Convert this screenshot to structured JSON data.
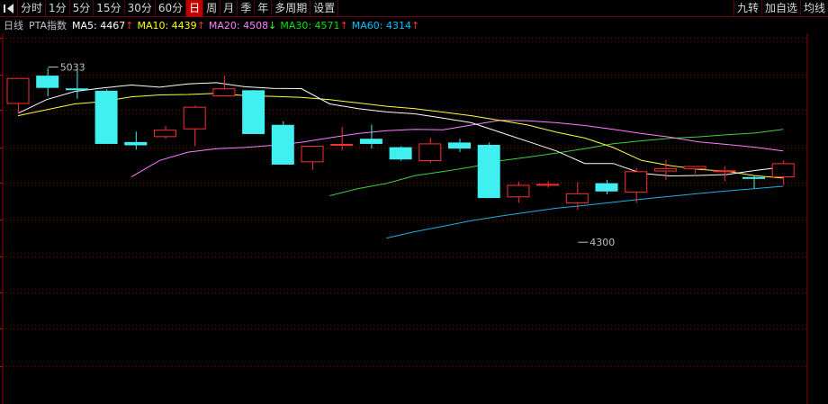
{
  "toolbar": {
    "tabs": [
      "分时",
      "1分",
      "5分",
      "15分",
      "30分",
      "60分",
      "日",
      "周",
      "月",
      "季",
      "年",
      "多周期",
      "设置"
    ],
    "active": "日",
    "right": [
      "九转",
      "加自选",
      "均线"
    ]
  },
  "legend": {
    "period": "日线",
    "name": "PTA指数",
    "items": [
      {
        "label": "MA5: 4467",
        "arrow": "↑",
        "color": "#ffffff",
        "arrow_color": "#ff3030"
      },
      {
        "label": "MA10: 4439",
        "arrow": "↑",
        "color": "#ffff00",
        "arrow_color": "#ff3030"
      },
      {
        "label": "MA20: 4508",
        "arrow": "↓",
        "color": "#ff80ff",
        "arrow_color": "#40ff40"
      },
      {
        "label": "MA30: 4571",
        "arrow": "↑",
        "color": "#00e000",
        "arrow_color": "#ff3030"
      },
      {
        "label": "MA60: 4314",
        "arrow": "↑",
        "color": "#00c0ff",
        "arrow_color": "#ff3030"
      }
    ]
  },
  "chart_data": {
    "type": "candlestick",
    "ylim": [
      3605,
      5180
    ],
    "grid": "dotted-horizontal",
    "colors": {
      "up": "#ff3030",
      "down": "#40f0f0",
      "ma5": "#ffffff",
      "ma10": "#ffff40",
      "ma20": "#ff80ff",
      "ma30": "#40d040",
      "ma60": "#20b0e0",
      "grid": "#8b0000",
      "label": "#c0c0c0"
    },
    "candles": [
      {
        "o": 4880,
        "h": 4990,
        "l": 4840,
        "c": 4990
      },
      {
        "o": 5000,
        "h": 5033,
        "l": 4912,
        "c": 4948
      },
      {
        "o": 4946,
        "h": 5030,
        "l": 4902,
        "c": 4941
      },
      {
        "o": 4936,
        "h": 4942,
        "l": 4710,
        "c": 4710
      },
      {
        "o": 4718,
        "h": 4762,
        "l": 4686,
        "c": 4704
      },
      {
        "o": 4739,
        "h": 4786,
        "l": 4732,
        "c": 4770
      },
      {
        "o": 4772,
        "h": 4872,
        "l": 4700,
        "c": 4868
      },
      {
        "o": 4912,
        "h": 5000,
        "l": 4912,
        "c": 4946
      },
      {
        "o": 4938,
        "h": 4940,
        "l": 4752,
        "c": 4752
      },
      {
        "o": 4791,
        "h": 4806,
        "l": 4622,
        "c": 4622
      },
      {
        "o": 4632,
        "h": 4700,
        "l": 4600,
        "c": 4702
      },
      {
        "o": 4710,
        "h": 4782,
        "l": 4682,
        "c": 4710
      },
      {
        "o": 4732,
        "h": 4792,
        "l": 4690,
        "c": 4710
      },
      {
        "o": 4696,
        "h": 4700,
        "l": 4638,
        "c": 4644
      },
      {
        "o": 4637,
        "h": 4736,
        "l": 4630,
        "c": 4712
      },
      {
        "o": 4716,
        "h": 4732,
        "l": 4676,
        "c": 4690
      },
      {
        "o": 4706,
        "h": 4716,
        "l": 4480,
        "c": 4480
      },
      {
        "o": 4483,
        "h": 4550,
        "l": 4460,
        "c": 4536
      },
      {
        "o": 4540,
        "h": 4552,
        "l": 4524,
        "c": 4540
      },
      {
        "o": 4457,
        "h": 4548,
        "l": 4430,
        "c": 4500
      },
      {
        "o": 4543,
        "h": 4558,
        "l": 4496,
        "c": 4508
      },
      {
        "o": 4503,
        "h": 4608,
        "l": 4460,
        "c": 4594
      },
      {
        "o": 4593,
        "h": 4641,
        "l": 4557,
        "c": 4607
      },
      {
        "o": 4602,
        "h": 4616,
        "l": 4584,
        "c": 4616
      },
      {
        "o": 4592,
        "h": 4616,
        "l": 4552,
        "c": 4598
      },
      {
        "o": 4569,
        "h": 4575,
        "l": 4520,
        "c": 4564
      },
      {
        "o": 4568,
        "h": 4641,
        "l": 4535,
        "c": 4628
      }
    ],
    "ma5": [
      4840,
      4898,
      4933,
      4948,
      4960,
      4951,
      4965,
      4970,
      4953,
      4946,
      4945,
      4880,
      4860,
      4846,
      4838,
      4820,
      4800,
      4760,
      4720,
      4680,
      4627,
      4627,
      4585,
      4574,
      4576,
      4580,
      4597,
      4612
    ],
    "ma10": [
      4830,
      4855,
      4880,
      4890,
      4910,
      4918,
      4920,
      4925,
      4915,
      4912,
      4908,
      4898,
      4884,
      4870,
      4860,
      4845,
      4830,
      4810,
      4790,
      4760,
      4735,
      4695,
      4640,
      4618,
      4602,
      4594,
      4575,
      4565
    ],
    "ma20": [
      4570,
      4640,
      4675,
      4690,
      4695,
      4704,
      4717,
      4736,
      4754,
      4766,
      4772,
      4770,
      4790,
      4810,
      4808,
      4800,
      4788,
      4772,
      4754,
      4739,
      4719,
      4708,
      4696,
      4680
    ],
    "ma30": [
      4490,
      4520,
      4542,
      4575,
      4593,
      4612,
      4638,
      4654,
      4671,
      4690,
      4711,
      4723,
      4734,
      4740,
      4749,
      4756,
      4772
    ],
    "ma60": [
      4310,
      4337,
      4360,
      4384,
      4403,
      4420,
      4437,
      4449,
      4462,
      4475,
      4487,
      4499,
      4510,
      4520,
      4530
    ],
    "annotations": [
      {
        "label": "5033",
        "value": 5033
      },
      {
        "label": "4300",
        "value": 4300
      }
    ]
  }
}
